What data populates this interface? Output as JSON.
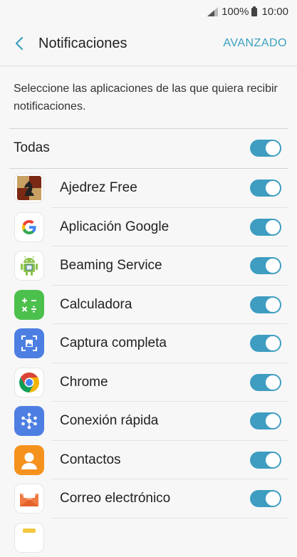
{
  "status": {
    "battery": "100%",
    "time": "10:00"
  },
  "header": {
    "title": "Notificaciones",
    "action": "AVANZADO"
  },
  "description": "Seleccione las aplicaciones de las que quiera recibir notificaciones.",
  "all": {
    "label": "Todas",
    "enabled": true
  },
  "apps": [
    {
      "name": "Ajedrez Free",
      "icon": "chess-knight-icon",
      "enabled": true
    },
    {
      "name": "Aplicación Google",
      "icon": "google-icon",
      "enabled": true
    },
    {
      "name": "Beaming Service",
      "icon": "android-robot-icon",
      "enabled": true
    },
    {
      "name": "Calculadora",
      "icon": "calculator-icon",
      "enabled": true
    },
    {
      "name": "Captura completa",
      "icon": "screenshot-icon",
      "enabled": true
    },
    {
      "name": "Chrome",
      "icon": "chrome-icon",
      "enabled": true
    },
    {
      "name": "Conexión rápida",
      "icon": "quick-connect-icon",
      "enabled": true
    },
    {
      "name": "Contactos",
      "icon": "contacts-icon",
      "enabled": true
    },
    {
      "name": "Correo electrónico",
      "icon": "email-icon",
      "enabled": true
    }
  ],
  "colors": {
    "accent": "#3e9dc1",
    "link": "#3a9fbf",
    "background": "#f7f7f7"
  }
}
